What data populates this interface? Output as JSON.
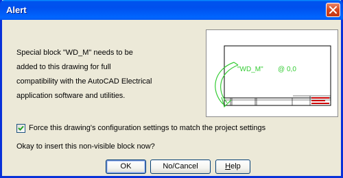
{
  "window": {
    "title": "Alert",
    "close_icon": "close-icon"
  },
  "message": {
    "lines": [
      "Special block \"WD_M\" needs to be",
      "added to this drawing for full",
      "compatibility with the AutoCAD Electrical",
      "application software and utilities."
    ]
  },
  "preview": {
    "block_label": "\"WD_M\"",
    "symbol": "@",
    "coords": "0,0"
  },
  "checkbox": {
    "label": "Force this drawing's configuration settings to match the project settings",
    "checked": true
  },
  "question": "Okay to insert this non-visible block now?",
  "buttons": {
    "ok": "OK",
    "no_cancel": "No/Cancel",
    "help_rest": "elp",
    "help_mnemonic": "H"
  },
  "colors": {
    "title_bar": "#0058f0",
    "close_button": "#d6461d",
    "preview_text": "#33cc33",
    "preview_red": "#cc0000"
  }
}
